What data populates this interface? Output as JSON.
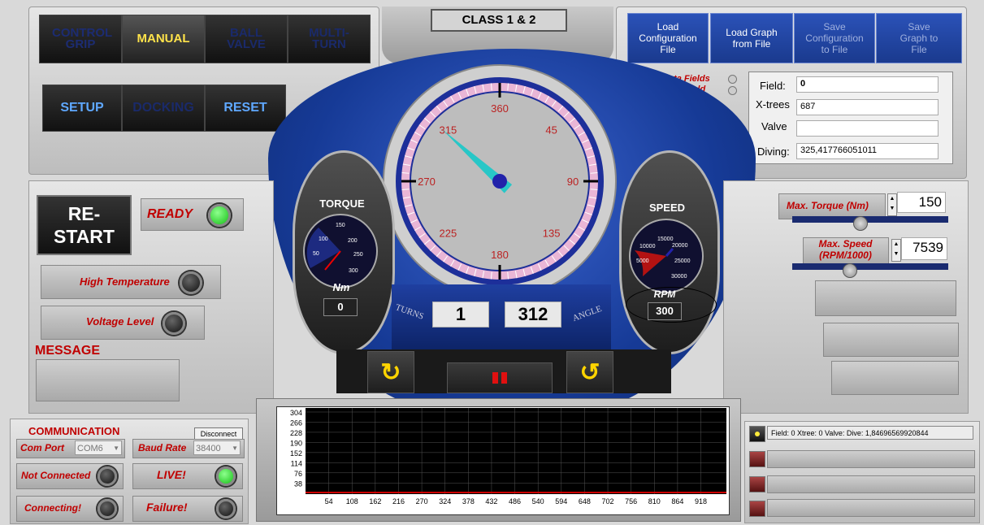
{
  "colors": {
    "accent_blue": "#1b3f9a",
    "ring_blue": "#1f3aa0",
    "led_green": "#1ed81e",
    "label_red": "#c00000"
  },
  "mode_tabs": {
    "control_grip": "CONTROL GRIP",
    "manual": "MANUAL",
    "ball_valve": "BALL VALVE",
    "multi_turn": "MULTI-TURN"
  },
  "actions": {
    "setup": "SETUP",
    "docking": "DOCKING",
    "reset": "RESET"
  },
  "class_label": "CLASS 1 & 2",
  "file_buttons": {
    "load_config": "Load Configuration File",
    "load_graph": "Load Graph from File",
    "save_config": "Save Configuration to File",
    "save_graph": "Save Graph to File"
  },
  "fields_panel": {
    "toggle_data": "Data Fields",
    "toggle_note": "Note Field",
    "field_label": "Field:",
    "field_value": "0",
    "xtrees_label": "X-trees",
    "xtrees_value": "687",
    "valve_label": "Valve",
    "valve_value": "",
    "diving_label": "Diving:",
    "diving_value": "325,417766051011"
  },
  "left_status": {
    "restart": "RE-START",
    "ready": "READY",
    "high_temp": "High Temperature",
    "voltage": "Voltage Level",
    "message": "MESSAGE",
    "message_text": ""
  },
  "torque": {
    "title": "TORQUE",
    "unit": "Nm",
    "value": "0",
    "ticks": [
      "50",
      "100",
      "150",
      "200",
      "250",
      "300"
    ]
  },
  "speed": {
    "title": "SPEED",
    "unit": "RPM",
    "value": "300",
    "ticks": [
      "5000",
      "10000",
      "15000",
      "20000",
      "25000",
      "30000"
    ]
  },
  "dial": {
    "ticks": [
      "360",
      "45",
      "90",
      "135",
      "180",
      "225",
      "270",
      "315"
    ],
    "angle_deg": 312
  },
  "turns": {
    "label": "TURNS",
    "value": "1"
  },
  "angle": {
    "label": "ANGLE",
    "value": "312"
  },
  "limits": {
    "max_torque_label": "Max. Torque (Nm)",
    "max_torque_value": "150",
    "max_speed_label": "Max. Speed (RPM/1000)",
    "max_speed_value": "7539"
  },
  "communication": {
    "title": "COMMUNICATION",
    "disconnect": "Disconnect",
    "com_port_label": "Com Port",
    "com_port_value": "COM6",
    "baud_label": "Baud Rate",
    "baud_value": "38400",
    "not_connected": "Not Connected",
    "live": "LIVE!",
    "connecting": "Connecting!",
    "failure": "Failure!"
  },
  "graph": {
    "y_ticks": [
      "304",
      "266",
      "228",
      "190",
      "152",
      "114",
      "76",
      "38"
    ],
    "x_ticks": [
      "54",
      "108",
      "162",
      "216",
      "270",
      "324",
      "378",
      "432",
      "486",
      "540",
      "594",
      "648",
      "702",
      "756",
      "810",
      "864",
      "918"
    ]
  },
  "log": {
    "line1": "Field: 0  Xtree: 0  Valve:   Dive: 1,84696569920844"
  }
}
